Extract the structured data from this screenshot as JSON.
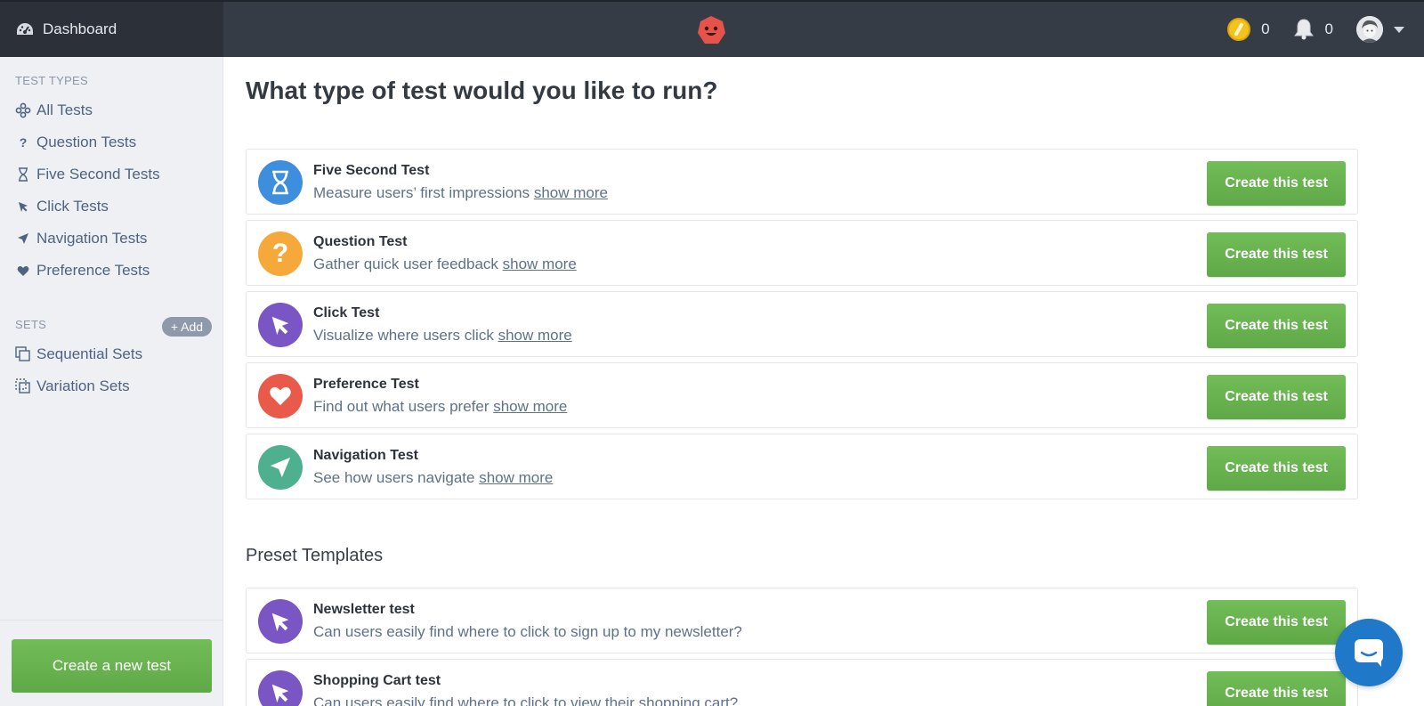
{
  "topbar": {
    "dashboard_label": "Dashboard",
    "credits_count": "0",
    "notifications_count": "0"
  },
  "sidebar": {
    "test_types_title": "TEST TYPES",
    "items": [
      {
        "label": "All Tests",
        "icon": "all-tests-icon"
      },
      {
        "label": "Question Tests",
        "icon": "question-icon"
      },
      {
        "label": "Five Second Tests",
        "icon": "hourglass-icon"
      },
      {
        "label": "Click Tests",
        "icon": "cursor-icon"
      },
      {
        "label": "Navigation Tests",
        "icon": "navigation-arrow-icon"
      },
      {
        "label": "Preference Tests",
        "icon": "heart-icon"
      }
    ],
    "sets_title": "SETS",
    "add_label": "+ Add",
    "sets": [
      {
        "label": "Sequential Sets",
        "icon": "sequential-sets-icon"
      },
      {
        "label": "Variation Sets",
        "icon": "variation-sets-icon"
      }
    ],
    "create_new_label": "Create a new test"
  },
  "main": {
    "title": "What type of test would you like to run?",
    "tests": [
      {
        "title": "Five Second Test",
        "desc": "Measure users’ first impressions",
        "more": "show more",
        "button": "Create this test",
        "color": "#3d8fde",
        "icon": "hourglass-icon"
      },
      {
        "title": "Question Test",
        "desc": "Gather quick user feedback",
        "more": "show more",
        "button": "Create this test",
        "color": "#f5a93a",
        "icon": "question-icon"
      },
      {
        "title": "Click Test",
        "desc": "Visualize where users click",
        "more": "show more",
        "button": "Create this test",
        "color": "#7a55c4",
        "icon": "cursor-icon"
      },
      {
        "title": "Preference Test",
        "desc": "Find out what users prefer",
        "more": "show more",
        "button": "Create this test",
        "color": "#ea5a4b",
        "icon": "heart-icon"
      },
      {
        "title": "Navigation Test",
        "desc": "See how users navigate",
        "more": "show more",
        "button": "Create this test",
        "color": "#4fb08f",
        "icon": "navigation-arrow-icon"
      }
    ],
    "presets_title": "Preset Templates",
    "presets": [
      {
        "title": "Newsletter test",
        "desc": "Can users easily find where to click to sign up to my newsletter?",
        "button": "Create this test",
        "color": "#7a55c4",
        "icon": "cursor-icon"
      },
      {
        "title": "Shopping Cart test",
        "desc": "Can users easily find where to click to view their shopping cart?",
        "button": "Create this test",
        "color": "#7a55c4",
        "icon": "cursor-icon"
      }
    ]
  },
  "colors": {
    "topbar": "#353c46",
    "sidebar": "#eef0f4",
    "accent_green": "#66b24d",
    "chat_blue": "#1f78c8"
  }
}
